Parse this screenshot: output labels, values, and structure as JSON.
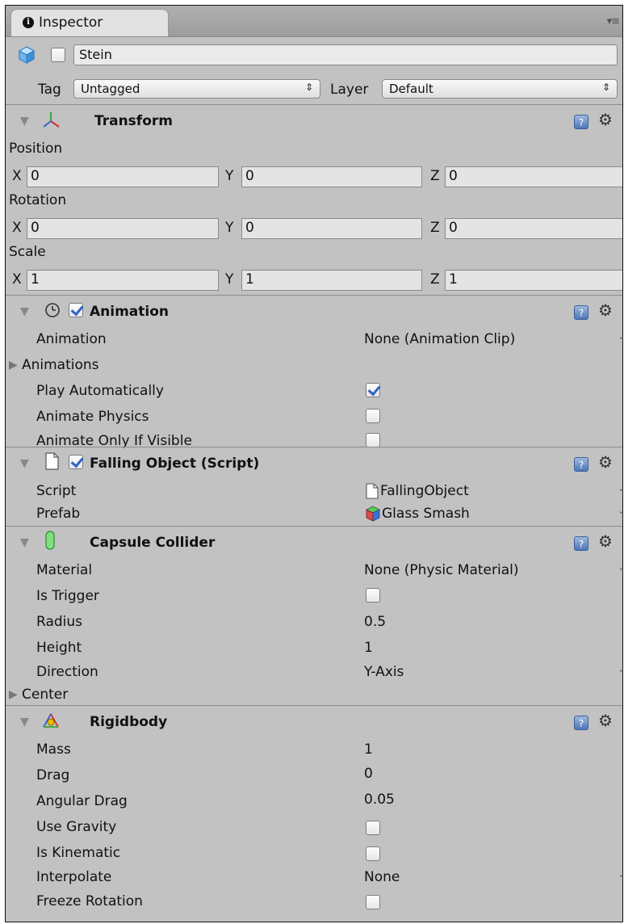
{
  "tab": {
    "label": "Inspector",
    "menu": "▾≡"
  },
  "object": {
    "name": "Stein"
  },
  "tag": {
    "label": "Tag",
    "value": "Untagged"
  },
  "layer": {
    "label": "Layer",
    "value": "Default"
  },
  "transform": {
    "title": "Transform",
    "position": {
      "label": "Position",
      "x": "0",
      "y": "0",
      "z": "0"
    },
    "rotation": {
      "label": "Rotation",
      "x": "0",
      "y": "0",
      "z": "0"
    },
    "scale": {
      "label": "Scale",
      "x": "1",
      "y": "1",
      "z": "1"
    },
    "axis": {
      "x": "X",
      "y": "Y",
      "z": "Z"
    }
  },
  "animation": {
    "title": "Animation",
    "animation_label": "Animation",
    "animation_value": "None (Animation Clip)",
    "animations_label": "Animations",
    "play_auto_label": "Play Automatically",
    "play_auto_checked": true,
    "animate_physics_label": "Animate Physics",
    "animate_physics_checked": false,
    "animate_visible_label": "Animate Only If Visible",
    "animate_visible_checked": false
  },
  "falling": {
    "title": "Falling Object (Script)",
    "script_label": "Script",
    "script_value": "FallingObject",
    "prefab_label": "Prefab",
    "prefab_value": "Glass Smash"
  },
  "capsule": {
    "title": "Capsule Collider",
    "material_label": "Material",
    "material_value": "None (Physic Material)",
    "trigger_label": "Is Trigger",
    "trigger_checked": false,
    "radius_label": "Radius",
    "radius_value": "0.5",
    "height_label": "Height",
    "height_value": "1",
    "direction_label": "Direction",
    "direction_value": "Y-Axis",
    "center_label": "Center"
  },
  "rigidbody": {
    "title": "Rigidbody",
    "mass_label": "Mass",
    "mass_value": "1",
    "drag_label": "Drag",
    "drag_value": "0",
    "angular_label": "Angular Drag",
    "angular_value": "0.05",
    "gravity_label": "Use Gravity",
    "gravity_checked": false,
    "kinematic_label": "Is Kinematic",
    "kinematic_checked": false,
    "interpolate_label": "Interpolate",
    "interpolate_value": "None",
    "freeze_label": "Freeze Rotation",
    "freeze_checked": false
  }
}
